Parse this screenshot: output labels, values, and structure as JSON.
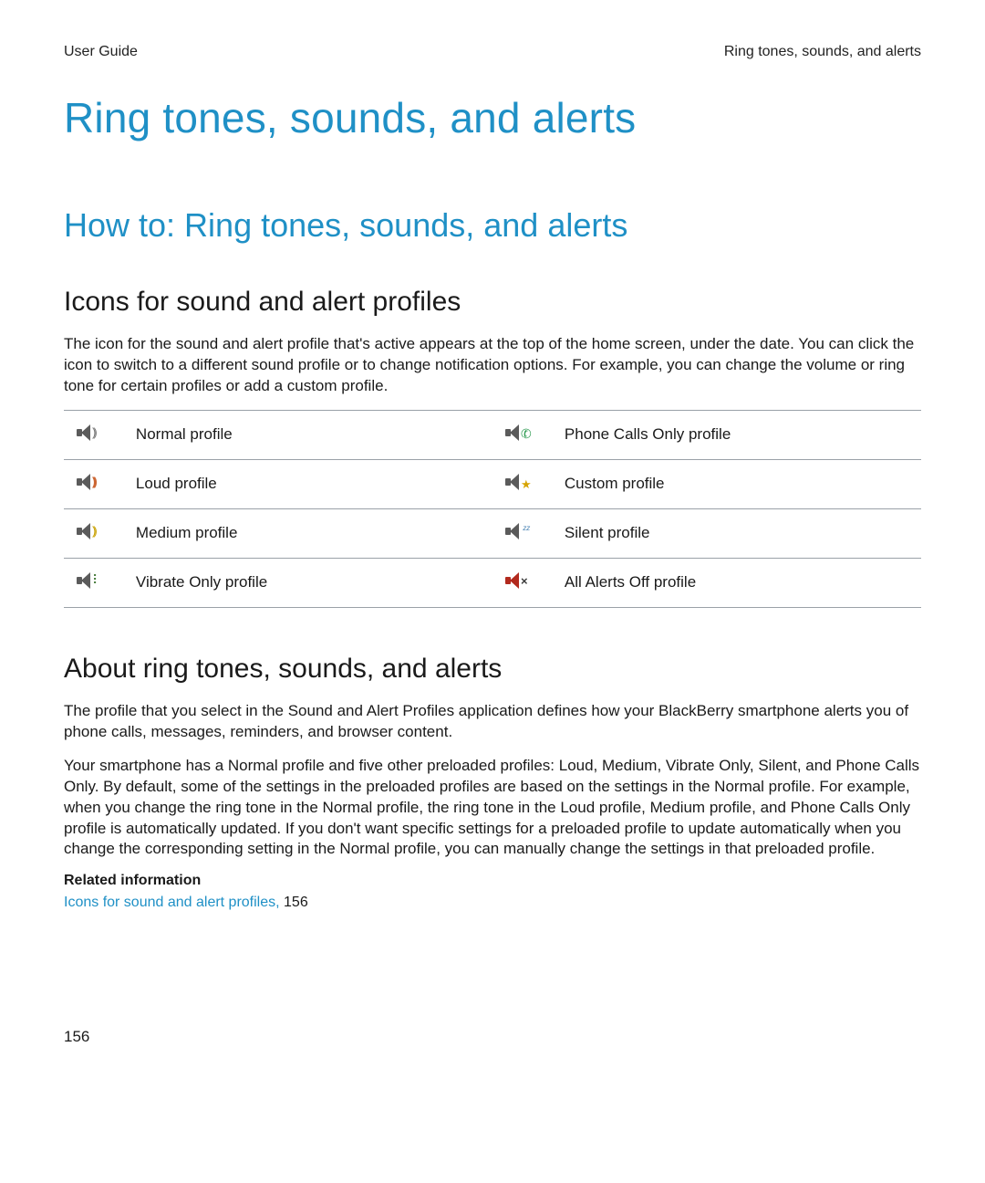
{
  "header": {
    "left": "User Guide",
    "right": "Ring tones, sounds, and alerts"
  },
  "title": "Ring tones, sounds, and alerts",
  "section_title": "How to: Ring tones, sounds, and alerts",
  "subsection1": {
    "title": "Icons for sound and alert profiles",
    "para": "The icon for the sound and alert profile that's active appears at the top of the home screen, under the date. You can click the icon to switch to a different sound profile or to change notification options. For example, you can change the volume or ring tone for certain profiles or add a custom profile."
  },
  "icons_table": {
    "rows": [
      {
        "left_icon": "speaker-normal-icon",
        "left_label": "Normal profile",
        "right_icon": "speaker-phone-icon",
        "right_label": "Phone Calls Only profile"
      },
      {
        "left_icon": "speaker-loud-icon",
        "left_label": "Loud profile",
        "right_icon": "speaker-custom-icon",
        "right_label": "Custom profile"
      },
      {
        "left_icon": "speaker-medium-icon",
        "left_label": "Medium profile",
        "right_icon": "speaker-silent-icon",
        "right_label": "Silent profile"
      },
      {
        "left_icon": "speaker-vibrate-icon",
        "left_label": "Vibrate Only profile",
        "right_icon": "speaker-off-icon",
        "right_label": "All Alerts Off profile"
      }
    ]
  },
  "subsection2": {
    "title": "About ring tones, sounds, and alerts",
    "para1": "The profile that you select in the Sound and Alert Profiles application defines how your BlackBerry smartphone alerts you of phone calls, messages, reminders, and browser content.",
    "para2": "Your smartphone has a Normal profile and five other preloaded profiles: Loud, Medium, Vibrate Only, Silent, and Phone Calls Only. By default, some of the settings in the preloaded profiles are based on the settings in the Normal profile. For example, when you change the ring tone in the Normal profile, the ring tone in the Loud profile, Medium profile, and Phone Calls Only profile is automatically updated. If you don't want specific settings for a preloaded profile to update automatically when you change the corresponding setting in the Normal profile, you can manually change the settings in that preloaded profile."
  },
  "related": {
    "heading": "Related information",
    "link_text": "Icons for sound and alert profiles,",
    "link_page": "156"
  },
  "page_number": "156"
}
